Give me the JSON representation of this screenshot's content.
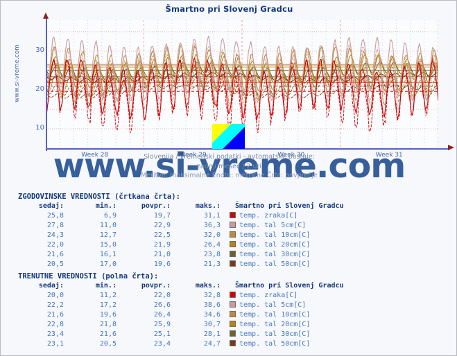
{
  "page": {
    "title": "Šmartno pri Slovenj Gradcu",
    "side_label": "www.si-vreme.com",
    "watermark": "www.si-vreme.com"
  },
  "subtitle": {
    "line1": "Slovenija / vremenski podatki - avtomatske postaje:",
    "line2": "zadnji mesec / 2 uri",
    "line3": "Meritve: maksimalne  Enote: metrične  Črta: povprečje"
  },
  "chart_data": {
    "type": "line",
    "title": "Šmartno pri Slovenj Gradcu",
    "xlabel": "",
    "ylabel": "",
    "ylim": [
      5,
      38
    ],
    "yticks": [
      10,
      20,
      30
    ],
    "xticks": [
      "Week 28",
      "Week 29",
      "Week 30",
      "Week 31"
    ],
    "grid": true,
    "legend_position": "below-right",
    "series": [
      {
        "name": "temp. zraka[C]",
        "color": "#d40000",
        "style": "solid",
        "sedaj": 20.0,
        "min": 11.2,
        "povpr": 22.0,
        "maks": 32.8
      },
      {
        "name": "temp. tal  5cm[C]",
        "color": "#c89a9a",
        "style": "solid",
        "sedaj": 22.2,
        "min": 17.2,
        "povpr": 26.6,
        "maks": 38.6
      },
      {
        "name": "temp. tal 10cm[C]",
        "color": "#c08a36",
        "style": "solid",
        "sedaj": 21.6,
        "min": 19.6,
        "povpr": 26.4,
        "maks": 34.6
      },
      {
        "name": "temp. tal 20cm[C]",
        "color": "#b5860b",
        "style": "solid",
        "sedaj": 22.8,
        "min": 21.8,
        "povpr": 25.9,
        "maks": 30.7
      },
      {
        "name": "temp. tal 30cm[C]",
        "color": "#6b6232",
        "style": "solid",
        "sedaj": 23.4,
        "min": 21.6,
        "povpr": 25.1,
        "maks": 28.1
      },
      {
        "name": "temp. tal 50cm[C]",
        "color": "#7a3a14",
        "style": "solid",
        "sedaj": 23.1,
        "min": 20.5,
        "povpr": 23.4,
        "maks": 24.7
      },
      {
        "name": "temp. zraka[C] (zgod.)",
        "color": "#d40000",
        "style": "dashed",
        "sedaj": 25.8,
        "min": 6.9,
        "povpr": 19.7,
        "maks": 31.1
      },
      {
        "name": "temp. tal  5cm[C] (zgod.)",
        "color": "#c89a9a",
        "style": "dashed",
        "sedaj": 27.8,
        "min": 11.0,
        "povpr": 22.9,
        "maks": 36.3
      },
      {
        "name": "temp. tal 10cm[C] (zgod.)",
        "color": "#c08a36",
        "style": "dashed",
        "sedaj": 24.3,
        "min": 12.7,
        "povpr": 22.5,
        "maks": 32.0
      },
      {
        "name": "temp. tal 20cm[C] (zgod.)",
        "color": "#b5860b",
        "style": "dashed",
        "sedaj": 22.0,
        "min": 15.0,
        "povpr": 21.9,
        "maks": 26.4
      },
      {
        "name": "temp. tal 30cm[C] (zgod.)",
        "color": "#6b6232",
        "style": "dashed",
        "sedaj": 21.6,
        "min": 16.1,
        "povpr": 21.0,
        "maks": 23.8
      },
      {
        "name": "temp. tal 50cm[C] (zgod.)",
        "color": "#7a3a14",
        "style": "dashed",
        "sedaj": 20.5,
        "min": 17.0,
        "povpr": 19.6,
        "maks": 21.3
      }
    ]
  },
  "historical": {
    "caption": "ZGODOVINSKE VREDNOSTI (črtkana črta):",
    "headers": [
      "sedaj:",
      "min.:",
      "povpr.:",
      "maks.:"
    ],
    "legend_header": "Šmartno pri Slovenj Gradcu",
    "rows": [
      {
        "sedaj": "25,8",
        "min": "6,9",
        "povpr": "19,7",
        "maks": "31,1",
        "label": "temp. zraka[C]",
        "color": "#d40000"
      },
      {
        "sedaj": "27,8",
        "min": "11,0",
        "povpr": "22,9",
        "maks": "36,3",
        "label": "temp. tal  5cm[C]",
        "color": "#c89a9a"
      },
      {
        "sedaj": "24,3",
        "min": "12,7",
        "povpr": "22,5",
        "maks": "32,0",
        "label": "temp. tal 10cm[C]",
        "color": "#c08a36"
      },
      {
        "sedaj": "22,0",
        "min": "15,0",
        "povpr": "21,9",
        "maks": "26,4",
        "label": "temp. tal 20cm[C]",
        "color": "#b5860b"
      },
      {
        "sedaj": "21,6",
        "min": "16,1",
        "povpr": "21,0",
        "maks": "23,8",
        "label": "temp. tal 30cm[C]",
        "color": "#6b6232"
      },
      {
        "sedaj": "20,5",
        "min": "17,0",
        "povpr": "19,6",
        "maks": "21,3",
        "label": "temp. tal 50cm[C]",
        "color": "#7a3a14"
      }
    ]
  },
  "current": {
    "caption": "TRENUTNE VREDNOSTI (polna črta):",
    "headers": [
      "sedaj:",
      "min.:",
      "povpr.:",
      "maks.:"
    ],
    "legend_header": "Šmartno pri Slovenj Gradcu",
    "rows": [
      {
        "sedaj": "20,0",
        "min": "11,2",
        "povpr": "22,0",
        "maks": "32,8",
        "label": "temp. zraka[C]",
        "color": "#d40000"
      },
      {
        "sedaj": "22,2",
        "min": "17,2",
        "povpr": "26,6",
        "maks": "38,6",
        "label": "temp. tal  5cm[C]",
        "color": "#c89a9a"
      },
      {
        "sedaj": "21,6",
        "min": "19,6",
        "povpr": "26,4",
        "maks": "34,6",
        "label": "temp. tal 10cm[C]",
        "color": "#c08a36"
      },
      {
        "sedaj": "22,8",
        "min": "21,8",
        "povpr": "25,9",
        "maks": "30,7",
        "label": "temp. tal 20cm[C]",
        "color": "#b5860b"
      },
      {
        "sedaj": "23,4",
        "min": "21,6",
        "povpr": "25,1",
        "maks": "28,1",
        "label": "temp. tal 30cm[C]",
        "color": "#6b6232"
      },
      {
        "sedaj": "23,1",
        "min": "20,5",
        "povpr": "23,4",
        "maks": "24,7",
        "label": "temp. tal 50cm[C]",
        "color": "#7a3a14"
      }
    ]
  }
}
